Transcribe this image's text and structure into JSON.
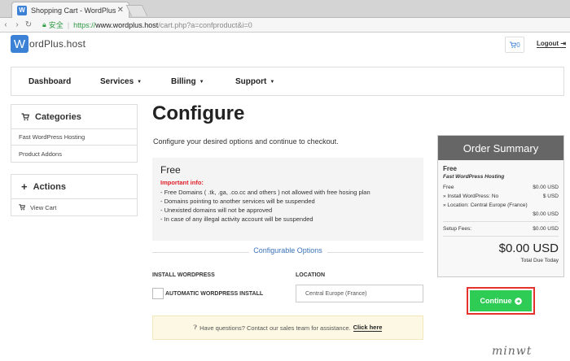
{
  "browser": {
    "tab_title": "Shopping Cart - WordPlus",
    "tab_favicon": "W",
    "secure_label": "安全",
    "url_scheme": "https://",
    "url_host": "www.wordplus.host",
    "url_path": "/cart.php?a=confproduct&i=0"
  },
  "header": {
    "logo_letter": "W",
    "logo_text": "ordPlus.host",
    "cart_count": "0",
    "logout_label": "Logout"
  },
  "nav": {
    "items": [
      "Dashboard",
      "Services",
      "Billing",
      "Support"
    ]
  },
  "sidebar": {
    "categories_title": "Categories",
    "categories": [
      "Fast WordPress Hosting",
      "Product Addons"
    ],
    "actions_title": "Actions",
    "actions": [
      "View Cart"
    ]
  },
  "main": {
    "title": "Configure",
    "subtitle": "Configure your desired options and continue to checkout.",
    "info": {
      "title": "Free",
      "important": "Important info:",
      "lines": [
        "- Free Domains ( .tk, .ga, .co.cc and others ) not allowed with free hosing plan",
        "- Domains pointing to another services will be suspended",
        "- Unexisted domains will not be approved",
        "- In case of any illegal activity account will be suspended"
      ]
    },
    "config_section": "Configurable Options",
    "install_label": "INSTALL WORDPRESS",
    "install_checkbox_label": "AUTOMATIC WORDPRESS INSTALL",
    "location_label": "LOCATION",
    "location_value": "Central Europe (France)",
    "help_text": "Have questions? Contact our sales team for assistance.",
    "help_link": "Click here"
  },
  "summary": {
    "title": "Order Summary",
    "plan": "Free",
    "product": "Fast WordPress Hosting",
    "rows": [
      {
        "label": "Free",
        "value": "$0.00 USD"
      },
      {
        "label": "» Install WordPress: No",
        "value": "$ USD"
      },
      {
        "label": "» Location: Central Europe (France)",
        "value": ""
      }
    ],
    "location_price": "$0.00 USD",
    "setup_label": "Setup Fees:",
    "setup_value": "$0.00 USD",
    "total": "$0.00 USD",
    "total_label": "Total Due Today"
  },
  "continue_label": "Continue",
  "watermark": "minwt",
  "colors": {
    "brand_blue": "#3b82d6",
    "continue_green": "#2ecc55",
    "highlight_red": "#e5322d",
    "important_red": "#e0202a"
  },
  "icons": {
    "cart": "cart-icon",
    "logout": "logout-icon",
    "actions": "plus-icon",
    "view_cart": "cart-icon",
    "help": "question-circle-icon",
    "continue": "arrow-circle-right-icon"
  }
}
